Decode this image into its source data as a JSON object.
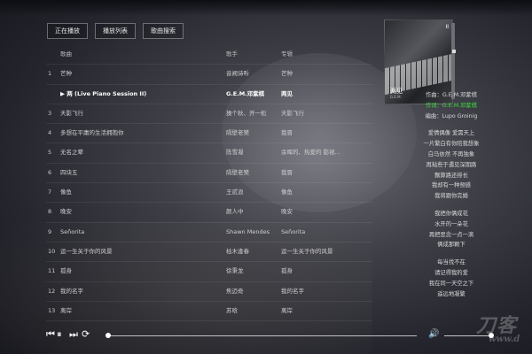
{
  "tabs": [
    "正在播放",
    "播放列表",
    "歌曲搜索"
  ],
  "table": {
    "header": {
      "num": "",
      "title": "歌曲",
      "artist": "歌手",
      "album": "专辑"
    },
    "rows": [
      {
        "num": "1",
        "title": "芒种",
        "artist": "音阙诗听",
        "album": "芒种"
      },
      {
        "num": "",
        "title": "▶ 两 (Live Piano Session II)",
        "artist": "G.E.M.邓紫棋",
        "album": "两见",
        "active": true
      },
      {
        "num": "3",
        "title": "天影飞行",
        "artist": "操个秋、开一松",
        "album": "天影飞行"
      },
      {
        "num": "4",
        "title": "多想在平庸的生活拥抱你",
        "artist": "隔壁老樊",
        "album": "我晋"
      },
      {
        "num": "5",
        "title": "无名之辈",
        "artist": "陈雪凝",
        "album": "余晖的、热爱的 影视..."
      },
      {
        "num": "6",
        "title": "四块五",
        "artist": "隔壁老樊",
        "album": "我晋"
      },
      {
        "num": "7",
        "title": "像鱼",
        "artist": "王贰浪",
        "album": "像鱼"
      },
      {
        "num": "8",
        "title": "晚安",
        "artist": "颜人中",
        "album": "晚安"
      },
      {
        "num": "9",
        "title": "Señorita",
        "artist": "Shawn Mendes",
        "album": "Señorita"
      },
      {
        "num": "10",
        "title": "运一生关于你的风景",
        "artist": "枯木逢春",
        "album": "运一生关于你的风景"
      },
      {
        "num": "11",
        "title": "孤身",
        "artist": "徐秉龙",
        "album": "孤身"
      },
      {
        "num": "12",
        "title": "我的名字",
        "artist": "焦迈奇",
        "album": "我的名字"
      },
      {
        "num": "13",
        "title": "离岸",
        "artist": "苏晗",
        "album": "离岸"
      }
    ]
  },
  "cover": {
    "title": "两见",
    "subtitle": "G.E.M.",
    "mark": "II"
  },
  "lyrics": [
    {
      "text": "作曲：G.E.M.邓紫棋",
      "type": "credit"
    },
    {
      "text": "作词：G.E.M.邓紫棋",
      "type": "credit-active"
    },
    {
      "text": "编曲：Lupo Groinig",
      "type": "credit"
    },
    {
      "text": "",
      "type": "gap"
    },
    {
      "text": "爱情偶像 爱需天上",
      "type": "line"
    },
    {
      "text": "一片繁白有你陪我想象",
      "type": "line"
    },
    {
      "text": "白马依然 不再独象",
      "type": "line"
    },
    {
      "text": "再粘些于遇见深期路",
      "type": "line"
    },
    {
      "text": "飘算路还排长",
      "type": "line"
    },
    {
      "text": "我却有一种预感",
      "type": "line"
    },
    {
      "text": "我将跟你完婚",
      "type": "line"
    },
    {
      "text": "",
      "type": "gap"
    },
    {
      "text": "我把你俩成花",
      "type": "line"
    },
    {
      "text": "水开的一朵花",
      "type": "line"
    },
    {
      "text": "再把思念一点一滴",
      "type": "line"
    },
    {
      "text": "俩成那颗下",
      "type": "line"
    },
    {
      "text": "",
      "type": "gap"
    },
    {
      "text": "每当找不在",
      "type": "line"
    },
    {
      "text": "请记得我的爱",
      "type": "line"
    },
    {
      "text": "我在同一天空之下",
      "type": "line"
    },
    {
      "text": "遥远地凝繁",
      "type": "line"
    }
  ],
  "player": {
    "icons": {
      "prev": "previous-icon",
      "pause": "pause-icon",
      "next": "next-icon",
      "loop": "loop-icon",
      "volume": "volume-icon"
    },
    "progress": 0.0,
    "volume": 0.96
  },
  "watermark": {
    "big": "刀客",
    "small": "www.d"
  }
}
